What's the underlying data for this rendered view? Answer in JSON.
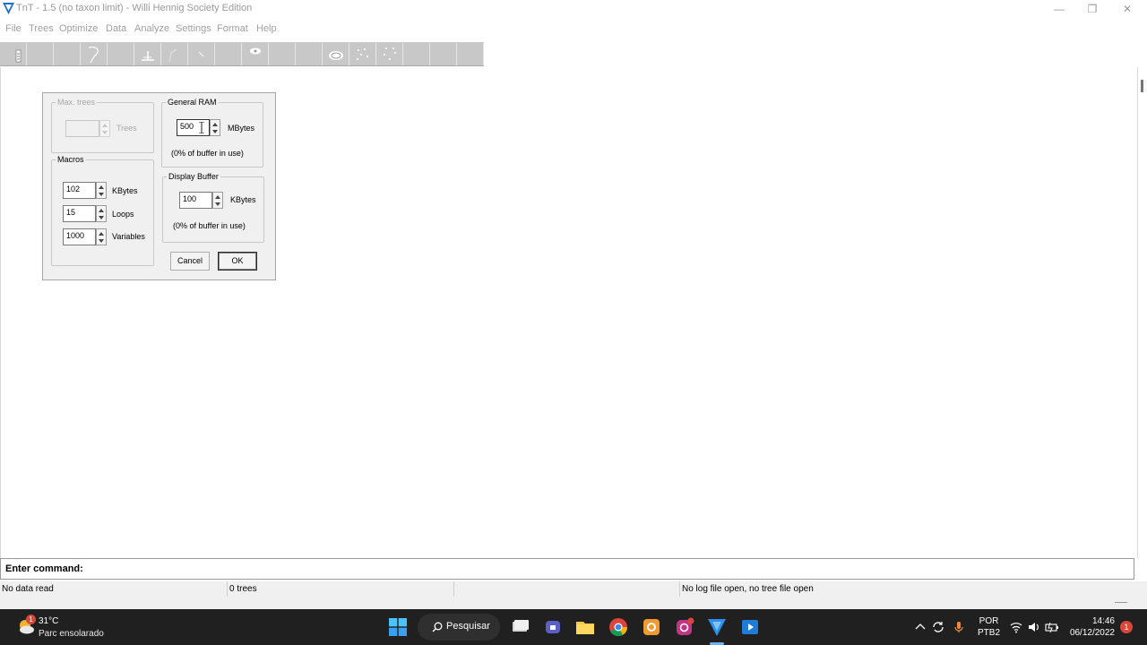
{
  "window": {
    "title": "TnT - 1.5 (no taxon limit) - Willi Hennig Society Edition",
    "controls": {
      "minimize": "—",
      "restore": "❐",
      "close": "✕"
    }
  },
  "menu": {
    "items": [
      "File",
      "Trees",
      "Optimize",
      "Data",
      "Analyze",
      "Settings",
      "Format",
      "Help"
    ]
  },
  "dialog": {
    "max_trees": {
      "legend": "Max. trees",
      "value": "",
      "unit": "Trees"
    },
    "general_ram": {
      "legend": "General RAM",
      "value": "500",
      "unit": "MBytes",
      "status": "(0% of buffer in use)"
    },
    "macros": {
      "legend": "Macros",
      "rows": [
        {
          "value": "102",
          "unit": "KBytes"
        },
        {
          "value": "15",
          "unit": "Loops"
        },
        {
          "value": "1000",
          "unit": "Variables"
        }
      ]
    },
    "display_buffer": {
      "legend": "Display Buffer",
      "value": "100",
      "unit": "KBytes",
      "status": "(0% of buffer in use)"
    },
    "buttons": {
      "cancel": "Cancel",
      "ok": "OK"
    }
  },
  "command": {
    "label": "Enter command:",
    "value": ""
  },
  "status": {
    "data": "No data read",
    "trees": "0 trees",
    "middle": "",
    "files": "No log file open, no tree file open"
  },
  "taskbar": {
    "weather": {
      "badge": "1",
      "temp": "31°C",
      "condition": "Parc ensolarado"
    },
    "search_label": "Pesquisar",
    "apps": [
      "file-explorer-icon",
      "teams-icon",
      "folder-icon",
      "chrome-icon",
      "chrome-canary-icon",
      "instagram-icon",
      "tnt-icon",
      "video-icon"
    ],
    "language": {
      "line1": "POR",
      "line2": "PTB2"
    },
    "clock": {
      "time": "14:46",
      "date": "06/12/2022"
    },
    "notification_count": "1"
  },
  "colors": {
    "accent_blue": "#1f6fd0",
    "toolbar_gray": "#c8c8c8",
    "taskbar": "#202020"
  }
}
